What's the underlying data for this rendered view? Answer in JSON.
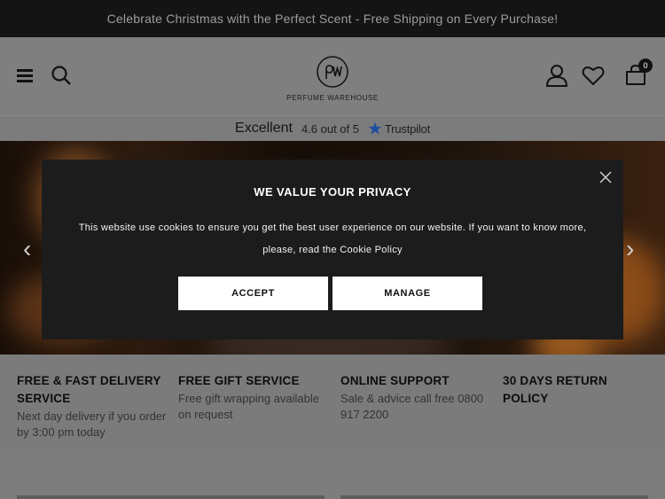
{
  "announcement": "Celebrate Christmas with the Perfect Scent - Free Shipping on Every Purchase!",
  "header": {
    "logo_mark": "pw",
    "logo_text": "PERFUME WAREHOUSE",
    "cart_count": "0",
    "icons": [
      "menu-icon",
      "search-icon",
      "account-icon",
      "wishlist-heart-icon",
      "shopping-bag-icon"
    ]
  },
  "trustpilot": {
    "rating_word": "Excellent",
    "score": "4.6 out of 5",
    "brand": "Trustpilot",
    "star_color": "#00b67a"
  },
  "features": [
    {
      "title": "FREE & FAST DELIVERY SERVICE",
      "desc": "Next day delivery if you order by 3:00 pm today"
    },
    {
      "title": "FREE GIFT SERVICE",
      "desc": "Free gift wrapping available on request"
    },
    {
      "title": "ONLINE SUPPORT",
      "desc": "Sale & advice call free 0800 917 2200"
    },
    {
      "title": "30 DAYS RETURN POLICY",
      "desc": ""
    }
  ],
  "cookie_modal": {
    "title": "WE VALUE YOUR PRIVACY",
    "body": "This website use cookies to ensure you get the best user experience on our website. If you want to know more, please, read the Cookie Policy",
    "accept_label": "ACCEPT",
    "manage_label": "MANAGE"
  }
}
